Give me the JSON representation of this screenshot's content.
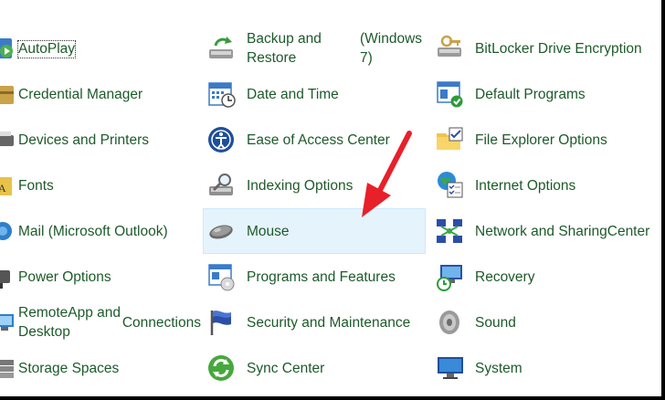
{
  "columns": [
    {
      "items": [
        {
          "label_lines": [
            "AutoPlay"
          ],
          "icon": "autoplay-icon"
        },
        {
          "label_lines": [
            "Credential Manager"
          ],
          "icon": "credential-manager-icon"
        },
        {
          "label_lines": [
            "Devices and Printers"
          ],
          "icon": "devices-printers-icon"
        },
        {
          "label_lines": [
            "Fonts"
          ],
          "icon": "fonts-icon"
        },
        {
          "label_lines": [
            "Mail (Microsoft Outlook)"
          ],
          "icon": "mail-icon"
        },
        {
          "label_lines": [
            "Power Options"
          ],
          "icon": "power-options-icon"
        },
        {
          "label_lines": [
            "RemoteApp and Desktop",
            "Connections"
          ],
          "icon": "remoteapp-icon"
        },
        {
          "label_lines": [
            "Storage Spaces"
          ],
          "icon": "storage-spaces-icon"
        }
      ]
    },
    {
      "items": [
        {
          "label_lines": [
            "Backup and Restore",
            "(Windows 7)"
          ],
          "icon": "backup-restore-icon"
        },
        {
          "label_lines": [
            "Date and Time"
          ],
          "icon": "date-time-icon"
        },
        {
          "label_lines": [
            "Ease of Access Center"
          ],
          "icon": "ease-of-access-icon"
        },
        {
          "label_lines": [
            "Indexing Options"
          ],
          "icon": "indexing-options-icon"
        },
        {
          "label_lines": [
            "Mouse"
          ],
          "icon": "mouse-icon"
        },
        {
          "label_lines": [
            "Programs and Features"
          ],
          "icon": "programs-features-icon"
        },
        {
          "label_lines": [
            "Security and Maintenance"
          ],
          "icon": "security-maintenance-icon"
        },
        {
          "label_lines": [
            "Sync Center"
          ],
          "icon": "sync-center-icon"
        }
      ]
    },
    {
      "items": [
        {
          "label_lines": [
            "BitLocker Drive Encryption"
          ],
          "icon": "bitlocker-icon"
        },
        {
          "label_lines": [
            "Default Programs"
          ],
          "icon": "default-programs-icon"
        },
        {
          "label_lines": [
            "File Explorer Options"
          ],
          "icon": "file-explorer-options-icon"
        },
        {
          "label_lines": [
            "Internet Options"
          ],
          "icon": "internet-options-icon"
        },
        {
          "label_lines": [
            "Network and Sharing",
            "Center"
          ],
          "icon": "network-sharing-icon"
        },
        {
          "label_lines": [
            "Recovery"
          ],
          "icon": "recovery-icon"
        },
        {
          "label_lines": [
            "Sound"
          ],
          "icon": "sound-icon"
        },
        {
          "label_lines": [
            "System"
          ],
          "icon": "system-icon"
        }
      ]
    }
  ],
  "colors": {
    "link_text": "#1d5a2a",
    "hover_bg": "#e5f3fd",
    "arrow": "#e8202a"
  }
}
